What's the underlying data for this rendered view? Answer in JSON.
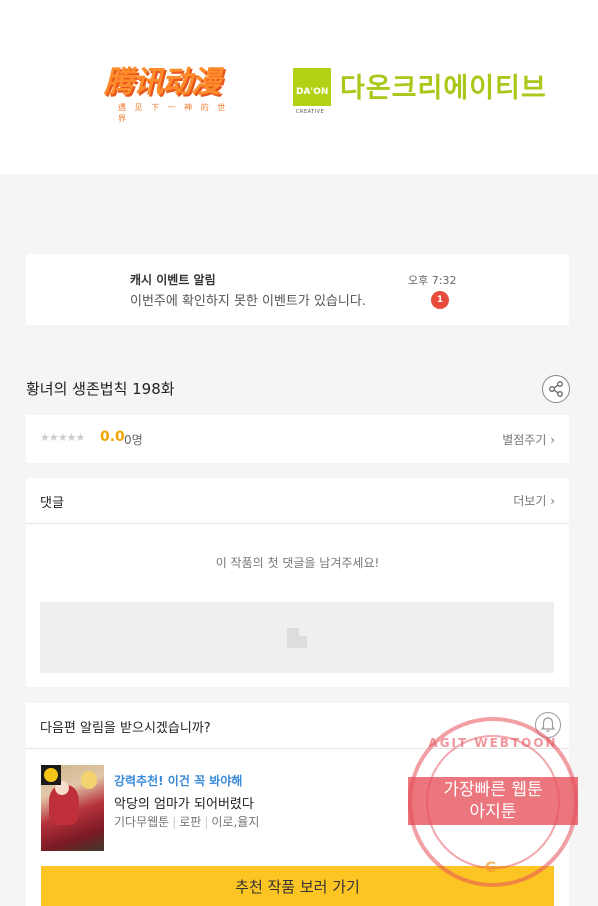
{
  "logos": {
    "tencent_mark": "腾讯动漫",
    "tencent_sub": "遇 见 下 一 神 的 世 界",
    "daon_box": "DA'ON",
    "daon_box_sub": "CREATIVE",
    "daon_text": "다온크리에이티브"
  },
  "event": {
    "title": "캐시 이벤트 알림",
    "message": "이번주에 확인하지 못한 이벤트가 있습니다.",
    "time": "오후 7:32",
    "badge": "1"
  },
  "episode": {
    "title": "황녀의 생존법칙 198화"
  },
  "rating": {
    "stars": "★★★★★",
    "score": "0.0",
    "count": "0명",
    "rate_link": "별점주기 ›"
  },
  "comments": {
    "header": "댓글",
    "more_link": "더보기 ›",
    "empty_message": "이 작품의 첫 댓글을 남겨주세요!"
  },
  "notify": {
    "header": "다음편 알림을 받으시겠습니까?",
    "promo": "강력추천! 이건 꼭 봐야해",
    "rec_title": "악당의 엄마가 되어버렸다",
    "rec_meta": [
      "기다무웹툰",
      "로판",
      "이로,율지"
    ],
    "cta_label": "추천 작품 보러 가기"
  },
  "stamp": {
    "top_text": "AGIT WEBTOON",
    "band_line1": "가장빠른 웹툰",
    "band_line2": "아지툰"
  },
  "colors": {
    "accent": "#fdc524",
    "badge": "#e74c3c",
    "promo": "#3b8ad9",
    "score": "#f0a500"
  }
}
